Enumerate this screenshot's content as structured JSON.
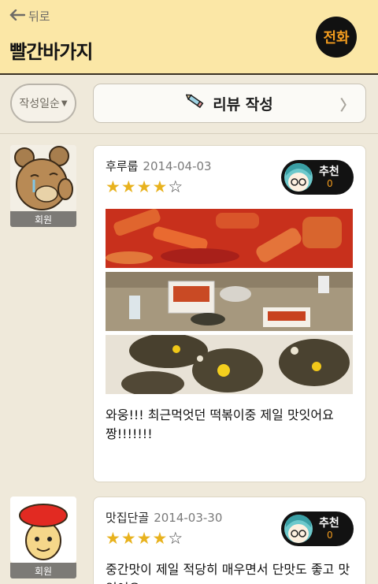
{
  "header": {
    "back_label": "뒤로",
    "title": "빨간바가지",
    "call_label": "전화"
  },
  "toolbar": {
    "sort_label": "작성일순",
    "write_review_label": "리뷰 작성"
  },
  "reviews": [
    {
      "author": "후루룹",
      "date": "2014-04-03",
      "rating": 4,
      "max_rating": 5,
      "member_label": "회원",
      "recommend_label": "추천",
      "recommend_count": "0",
      "text": "와웅!!! 최근먹엇던 떡볶이중 제일 맛잇어요\n짱!!!!!!!"
    },
    {
      "author": "맛집단골",
      "date": "2014-03-30",
      "rating": 4,
      "max_rating": 5,
      "member_label": "회원",
      "recommend_label": "추천",
      "recommend_count": "0",
      "text": "중간맛이 제일 적당히 매우면서 단맛도 좋고 맛있어요"
    }
  ],
  "colors": {
    "header_bg": "#fbe7a6",
    "accent_orange": "#f39c1e",
    "star_gold": "#e8b21e",
    "page_bg": "#efe9da"
  }
}
